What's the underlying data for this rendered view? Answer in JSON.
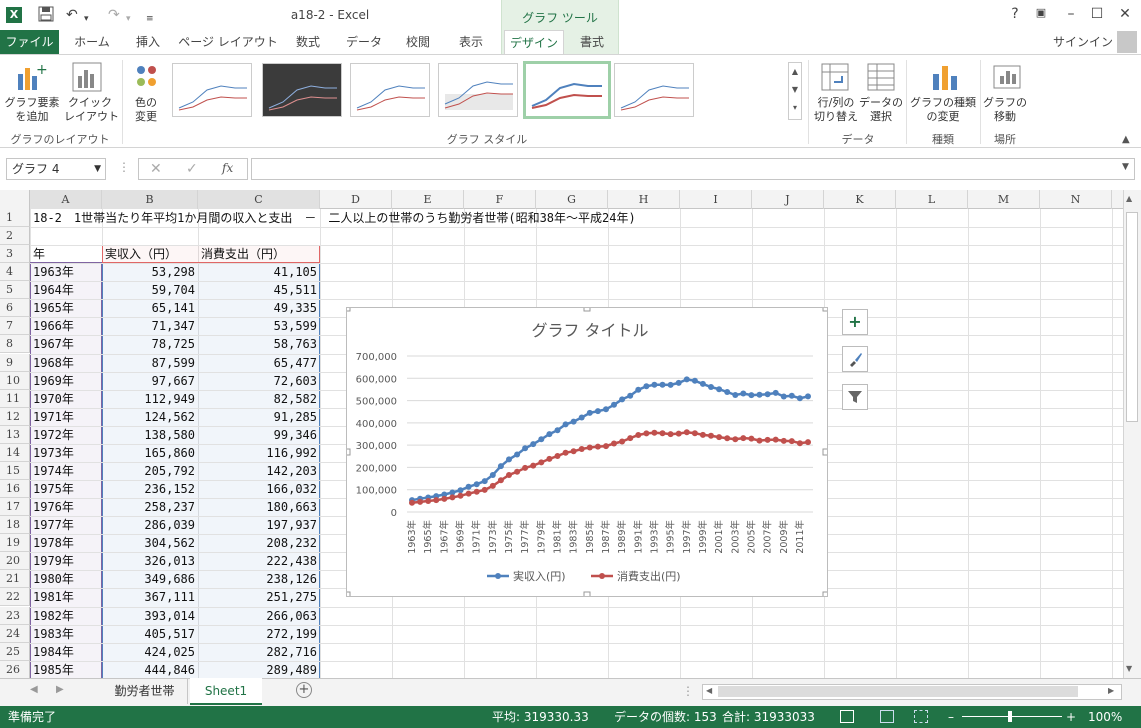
{
  "window": {
    "title": "a18-2 - Excel",
    "tools_label": "グラフ ツール",
    "signin": "サインイン"
  },
  "quick_access": {
    "save_icon": "save-icon",
    "undo_icon": "undo-icon",
    "redo_icon": "redo-icon"
  },
  "tabs": [
    "ファイル",
    "ホーム",
    "挿入",
    "ページ レイアウト",
    "数式",
    "データ",
    "校閲",
    "表示",
    "デザイン",
    "書式"
  ],
  "ribbon": {
    "add_element": "グラフ要素\nを追加",
    "quick_layout": "クイック\nレイアウト",
    "group_layout": "グラフのレイアウト",
    "colors": "色の\n変更",
    "group_styles": "グラフ スタイル",
    "switch_rowcol": "行/列の\n切り替え",
    "select_data": "データの\n選択",
    "group_data": "データ",
    "change_type": "グラフの種類\nの変更",
    "group_type": "種類",
    "move_chart": "グラフの\n移動",
    "group_location": "場所"
  },
  "formula_bar": {
    "name_box": "グラフ 4",
    "fx": "fx",
    "formula": ""
  },
  "columns": [
    "A",
    "B",
    "C",
    "D",
    "E",
    "F",
    "G",
    "H",
    "I",
    "J",
    "K",
    "L",
    "M",
    "N"
  ],
  "sheet": {
    "title_row": "18-2　1世帯当たり年平均1か月間の収入と支出　－　二人以上の世帯のうち勤労者世帯(昭和38年～平成24年)",
    "headers": [
      "年",
      "実収入（円）",
      "消費支出（円）"
    ],
    "rows": [
      [
        "1963年",
        "53,298",
        "41,105"
      ],
      [
        "1964年",
        "59,704",
        "45,511"
      ],
      [
        "1965年",
        "65,141",
        "49,335"
      ],
      [
        "1966年",
        "71,347",
        "53,599"
      ],
      [
        "1967年",
        "78,725",
        "58,763"
      ],
      [
        "1968年",
        "87,599",
        "65,477"
      ],
      [
        "1969年",
        "97,667",
        "72,603"
      ],
      [
        "1970年",
        "112,949",
        "82,582"
      ],
      [
        "1971年",
        "124,562",
        "91,285"
      ],
      [
        "1972年",
        "138,580",
        "99,346"
      ],
      [
        "1973年",
        "165,860",
        "116,992"
      ],
      [
        "1974年",
        "205,792",
        "142,203"
      ],
      [
        "1975年",
        "236,152",
        "166,032"
      ],
      [
        "1976年",
        "258,237",
        "180,663"
      ],
      [
        "1977年",
        "286,039",
        "197,937"
      ],
      [
        "1978年",
        "304,562",
        "208,232"
      ],
      [
        "1979年",
        "326,013",
        "222,438"
      ],
      [
        "1980年",
        "349,686",
        "238,126"
      ],
      [
        "1981年",
        "367,111",
        "251,275"
      ],
      [
        "1982年",
        "393,014",
        "266,063"
      ],
      [
        "1983年",
        "405,517",
        "272,199"
      ],
      [
        "1984年",
        "424,025",
        "282,716"
      ],
      [
        "1985年",
        "444,846",
        "289,489"
      ]
    ]
  },
  "chart_data": {
    "type": "line",
    "title": "グラフ タイトル",
    "ylim": [
      0,
      700000
    ],
    "yticks": [
      "0",
      "100,000",
      "200,000",
      "300,000",
      "400,000",
      "500,000",
      "600,000",
      "700,000"
    ],
    "xticks": [
      "1963年",
      "1965年",
      "1967年",
      "1969年",
      "1971年",
      "1973年",
      "1975年",
      "1977年",
      "1979年",
      "1981年",
      "1983年",
      "1985年",
      "1987年",
      "1989年",
      "1991年",
      "1993年",
      "1995年",
      "1997年",
      "1999年",
      "2001年",
      "2003年",
      "2005年",
      "2007年",
      "2009年",
      "2011年"
    ],
    "x_start_year": 1963,
    "series": [
      {
        "name": "実収入(円)",
        "color": "#4f81bd",
        "values": [
          53298,
          59704,
          65141,
          71347,
          78725,
          87599,
          97667,
          112949,
          124562,
          138580,
          165860,
          205792,
          236152,
          258237,
          286039,
          304562,
          326013,
          349686,
          367111,
          393014,
          405517,
          424025,
          444846,
          452942,
          460613,
          481250,
          505288,
          521757,
          548769,
          563855,
          570545,
          570817,
          570527,
          579461,
          595214,
          588916,
          574676,
          560954,
          551160,
          538277,
          524810,
          531690,
          524585,
          525719,
          528762,
          534235,
          518226,
          521239,
          510149,
          518506
        ]
      },
      {
        "name": "消費支出(円)",
        "color": "#c0504d",
        "values": [
          41105,
          45511,
          49335,
          53599,
          58763,
          65477,
          72603,
          82582,
          91285,
          99346,
          116992,
          142203,
          166032,
          180663,
          197937,
          208232,
          222438,
          238126,
          251275,
          266063,
          272199,
          282716,
          289489,
          293630,
          295915,
          307204,
          316489,
          331595,
          345473,
          352820,
          355276,
          353116,
          349663,
          351755,
          357636,
          353552,
          346177,
          341896,
          336209,
          330651,
          326566,
          331636,
          329499,
          320231,
          323459,
          324929,
          319060,
          318315,
          308838,
          313874
        ]
      }
    ],
    "legend": "bottom"
  },
  "sheet_tabs": [
    "勤労者世帯",
    "Sheet1"
  ],
  "status": {
    "ready": "準備完了",
    "average": "平均: 319330.33",
    "count": "データの個数: 153",
    "sum": "合計: 31933033",
    "zoom": "100%"
  }
}
